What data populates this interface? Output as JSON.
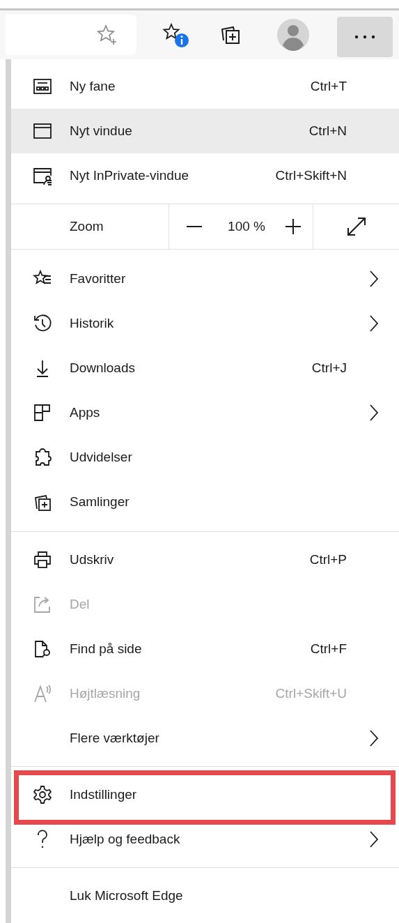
{
  "toolbar": {
    "more_button": {
      "pressed": true
    }
  },
  "menu": {
    "groups": [
      {
        "items": [
          {
            "kind": "item",
            "label": "Ny fane",
            "shortcut": "Ctrl+T",
            "submenu": false,
            "disabled": false,
            "highlighted": false,
            "outlined": false
          },
          {
            "kind": "item",
            "label": "Nyt vindue",
            "shortcut": "Ctrl+N",
            "submenu": false,
            "disabled": false,
            "highlighted": true,
            "outlined": false
          },
          {
            "kind": "item",
            "label": "Nyt InPrivate-vindue",
            "shortcut": "Ctrl+Skift+N",
            "submenu": false,
            "disabled": false,
            "highlighted": false,
            "outlined": false
          }
        ]
      },
      {
        "items": [
          {
            "kind": "zoom",
            "label": "Zoom",
            "value": "100 %"
          }
        ]
      },
      {
        "items": [
          {
            "kind": "item",
            "label": "Favoritter",
            "submenu": true,
            "disabled": false,
            "highlighted": false,
            "outlined": false
          },
          {
            "kind": "item",
            "label": "Historik",
            "submenu": true,
            "disabled": false,
            "highlighted": false,
            "outlined": false
          },
          {
            "kind": "item",
            "label": "Downloads",
            "shortcut": "Ctrl+J",
            "submenu": false,
            "disabled": false,
            "highlighted": false,
            "outlined": false
          },
          {
            "kind": "item",
            "label": "Apps",
            "submenu": true,
            "disabled": false,
            "highlighted": false,
            "outlined": false
          },
          {
            "kind": "item",
            "label": "Udvidelser",
            "submenu": false,
            "disabled": false,
            "highlighted": false,
            "outlined": false
          },
          {
            "kind": "item",
            "label": "Samlinger",
            "submenu": false,
            "disabled": false,
            "highlighted": false,
            "outlined": false
          }
        ]
      },
      {
        "items": [
          {
            "kind": "item",
            "label": "Udskriv",
            "shortcut": "Ctrl+P",
            "submenu": false,
            "disabled": false,
            "highlighted": false,
            "outlined": false
          },
          {
            "kind": "item",
            "label": "Del",
            "submenu": false,
            "disabled": true,
            "highlighted": false,
            "outlined": false
          },
          {
            "kind": "item",
            "label": "Find på side",
            "shortcut": "Ctrl+F",
            "submenu": false,
            "disabled": false,
            "highlighted": false,
            "outlined": false
          },
          {
            "kind": "item",
            "label": "Højtlæsning",
            "shortcut": "Ctrl+Skift+U",
            "submenu": false,
            "disabled": true,
            "highlighted": false,
            "outlined": false
          },
          {
            "kind": "item",
            "label": "Flere værktøjer",
            "submenu": true,
            "disabled": false,
            "highlighted": false,
            "outlined": false
          }
        ]
      },
      {
        "items": [
          {
            "kind": "item",
            "label": "Indstillinger",
            "submenu": false,
            "disabled": false,
            "highlighted": false,
            "outlined": true
          },
          {
            "kind": "item",
            "label": "Hjælp og feedback",
            "submenu": true,
            "disabled": false,
            "highlighted": false,
            "outlined": false
          }
        ]
      },
      {
        "items": [
          {
            "kind": "item",
            "label": "Luk Microsoft Edge",
            "submenu": false,
            "disabled": false,
            "highlighted": false,
            "outlined": false
          }
        ]
      }
    ]
  }
}
